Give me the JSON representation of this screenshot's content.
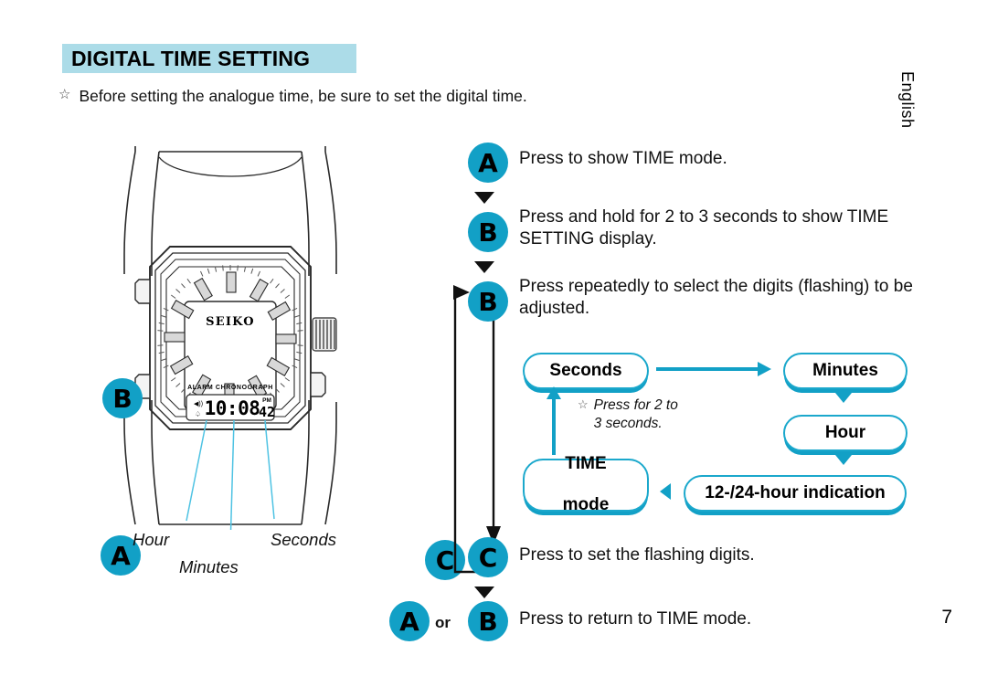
{
  "header": {
    "title": "DIGITAL TIME SETTING",
    "title_bg": "#ACDCE8",
    "lead_bullet": "☆",
    "lead_text": "Before setting the analogue time, be sure to set the digital time.",
    "language_tab": "English",
    "page_number": "7"
  },
  "accent": {
    "cyan": "#12A0C6",
    "pill_border": "#1BA8CC",
    "callout_line": "#4FC3E3"
  },
  "watch": {
    "brand": "SEIKO",
    "subtitle": "ALARM CHRONOGRAPH",
    "lcd": {
      "hour": "10",
      "colon": ":",
      "minutes": "08",
      "seconds": "42",
      "pm_indicator": "PM",
      "alarm_icon": "alarm-bell-icon",
      "chime_icon": "chime-icon"
    },
    "buttons": {
      "upper_left": "B",
      "lower_left": "A",
      "lower_right": "C"
    },
    "callouts": {
      "hour": "Hour",
      "minutes": "Minutes",
      "seconds": "Seconds"
    }
  },
  "steps": [
    {
      "badge": "A",
      "text": "Press to show TIME mode."
    },
    {
      "badge": "B",
      "text": "Press and hold for 2 to 3 seconds to show TIME SETTING display."
    },
    {
      "badge": "B",
      "text": "Press repeatedly to select the digits (flashing) to be adjusted."
    },
    {
      "badge": "C",
      "text": "Press to set the flashing digits."
    },
    {
      "badge": "B",
      "text": "Press to return to TIME mode."
    }
  ],
  "final_step": {
    "badge_a": "A",
    "or_label": "or",
    "badge_b": "B"
  },
  "flow": {
    "seconds": "Seconds",
    "minutes": "Minutes",
    "hour": "Hour",
    "hour_indication": "12-/24-hour indication",
    "time_mode_line1": "TIME",
    "time_mode_line2": "mode",
    "note_bullet": "☆",
    "note_line1": "Press for 2 to",
    "note_line2": "3 seconds."
  }
}
